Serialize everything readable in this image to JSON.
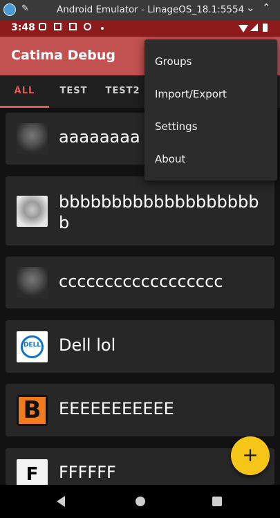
{
  "window": {
    "title": "Android Emulator - LinageOS_18.1:5554"
  },
  "status": {
    "time": "3:48"
  },
  "toolbar": {
    "title": "Catima Debug"
  },
  "tabs": [
    {
      "label": "ALL",
      "active": true
    },
    {
      "label": "TEST",
      "active": false
    },
    {
      "label": "TEST2",
      "active": false
    }
  ],
  "cards": [
    {
      "name": "aaaaaaaa",
      "icon": "wolf-dark"
    },
    {
      "name": "bbbbbbbbbbbbbbbbbbbb",
      "icon": "wolf-light"
    },
    {
      "name": "cccccccccccccccccc",
      "icon": "wolf-dark"
    },
    {
      "name": "Dell lol",
      "icon": "dell-logo",
      "icon_text": "DELL"
    },
    {
      "name": "EEEEEEEEEEE",
      "icon": "letter-b",
      "icon_text": "B"
    },
    {
      "name": "FFFFFF",
      "icon": "letter-f",
      "icon_text": "F"
    }
  ],
  "menu": {
    "items": [
      "Groups",
      "Import/Export",
      "Settings",
      "About"
    ]
  },
  "fab": {
    "label": "+"
  },
  "colors": {
    "toolbar": "#c25151",
    "status_bar": "#8e1b1b",
    "accent": "#e05a5a",
    "fab": "#f5c518"
  }
}
